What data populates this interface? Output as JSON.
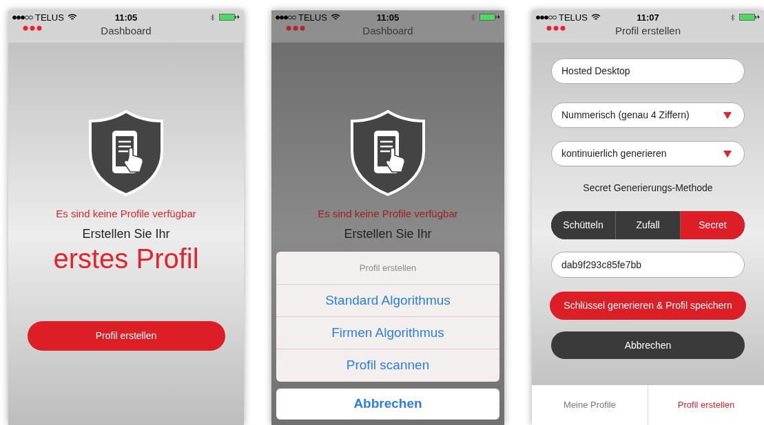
{
  "screens": [
    {
      "kind": "empty",
      "dimmed": false,
      "status": {
        "carrier": "TELUS",
        "time": "11:05"
      },
      "title": "Dashboard",
      "message": "Es sind keine Profile verfügbar",
      "prompt": "Erstellen Sie Ihr",
      "headline": "erstes Profil",
      "button": "Profil erstellen"
    },
    {
      "kind": "empty",
      "dimmed": true,
      "status": {
        "carrier": "TELUS",
        "time": "11:05"
      },
      "title": "Dashboard",
      "message": "Es sind keine Profile verfügbar",
      "prompt": "Erstellen Sie Ihr",
      "action_sheet": {
        "title": "Profil erstellen",
        "options": [
          "Standard Algorithmus",
          "Firmen Algorithmus",
          "Profil scannen"
        ],
        "cancel": "Abbrechen"
      }
    },
    {
      "kind": "form",
      "dimmed": false,
      "status": {
        "carrier": "TELUS",
        "time": "11:07"
      },
      "title": "Profil erstellen",
      "fields": [
        {
          "kind": "text",
          "value": "Hosted Desktop"
        },
        {
          "kind": "dropdown",
          "value": "Nummerisch (genau 4 Ziffern)"
        },
        {
          "kind": "dropdown",
          "value": "kontinuierlich generieren"
        }
      ],
      "section_label": "Secret Generierungs-Methode",
      "segments": [
        {
          "label": "Schütteln",
          "selected": false
        },
        {
          "label": "Zufall",
          "selected": false
        },
        {
          "label": "Secret",
          "selected": true
        }
      ],
      "secret": "dab9f293c85fe7bb",
      "primary_button": "Schlüssel generieren & Profil speichern",
      "cancel_button": "Abbrechen",
      "tabs": [
        {
          "label": "Meine Profile",
          "selected": false
        },
        {
          "label": "Profil erstellen",
          "selected": true
        }
      ]
    }
  ]
}
